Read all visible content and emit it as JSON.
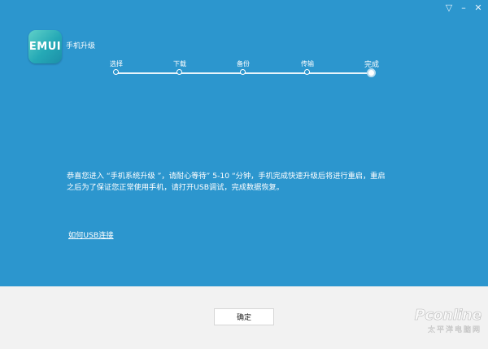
{
  "window": {
    "controls": [
      "▽",
      "–",
      "✕"
    ]
  },
  "app": {
    "logo_text": "EMUI",
    "title": "手机升级"
  },
  "steps": [
    {
      "label": "选择",
      "active": false
    },
    {
      "label": "下载",
      "active": false
    },
    {
      "label": "备份",
      "active": false
    },
    {
      "label": "传输",
      "active": false
    },
    {
      "label": "完成",
      "active": true
    }
  ],
  "message": {
    "line1": "恭喜您进入 “手机系统升级 ”，请耐心等待” 5-10 “分钟，手机完成快速升级后将进行重启，重启",
    "line2": "之后为了保证您正常使用手机，请打开USB调试，完成数据恢复。"
  },
  "usb_link": "如何USB连接",
  "footer": {
    "ok_label": "确定"
  },
  "watermark": {
    "brand": "Pconline",
    "sub": "太平洋电脑网"
  },
  "colors": {
    "main_bg": "#2c96ce",
    "footer_bg": "#f2f2f2"
  }
}
